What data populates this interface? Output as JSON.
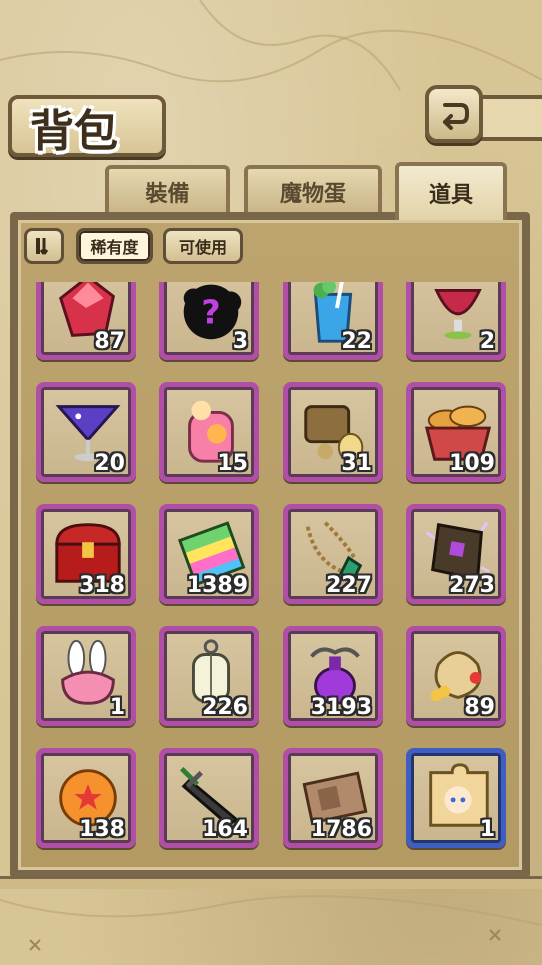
{
  "header": {
    "title": "背包"
  },
  "tabs": [
    {
      "label": "裝備",
      "active": false
    },
    {
      "label": "魔物蛋",
      "active": false
    },
    {
      "label": "道具",
      "active": true
    }
  ],
  "controls": {
    "filters": [
      {
        "label": "稀有度",
        "selected": true
      },
      {
        "label": "可使用",
        "selected": false
      }
    ]
  },
  "inventory": {
    "items": [
      {
        "icon": "red-gem-icon",
        "count": "87",
        "frame": "purple"
      },
      {
        "icon": "mystery-item-icon",
        "count": "3",
        "frame": "purple"
      },
      {
        "icon": "blue-drink-icon",
        "count": "22",
        "frame": "purple"
      },
      {
        "icon": "red-goblet-icon",
        "count": "2",
        "frame": "purple"
      },
      {
        "icon": "purple-cocktail-icon",
        "count": "20",
        "frame": "purple"
      },
      {
        "icon": "peach-juice-icon",
        "count": "15",
        "frame": "purple"
      },
      {
        "icon": "treasure-chest-items-icon",
        "count": "31",
        "frame": "purple"
      },
      {
        "icon": "bread-basket-icon",
        "count": "109",
        "frame": "purple"
      },
      {
        "icon": "red-chest-icon",
        "count": "318",
        "frame": "purple"
      },
      {
        "icon": "rainbow-book-icon",
        "count": "1389",
        "frame": "purple"
      },
      {
        "icon": "gem-necklace-icon",
        "count": "227",
        "frame": "purple"
      },
      {
        "icon": "magic-tome-icon",
        "count": "273",
        "frame": "purple"
      },
      {
        "icon": "bunny-hat-icon",
        "count": "1",
        "frame": "purple"
      },
      {
        "icon": "lantern-icon",
        "count": "226",
        "frame": "purple"
      },
      {
        "icon": "purple-potion-icon",
        "count": "3193",
        "frame": "purple"
      },
      {
        "icon": "gold-sack-icon",
        "count": "89",
        "frame": "purple"
      },
      {
        "icon": "star-orb-icon",
        "count": "138",
        "frame": "purple"
      },
      {
        "icon": "dark-sword-icon",
        "count": "164",
        "frame": "purple"
      },
      {
        "icon": "card-ticket-icon",
        "count": "1786",
        "frame": "purple"
      },
      {
        "icon": "puzzle-portrait-icon",
        "count": "1",
        "frame": "blue"
      }
    ]
  },
  "colors": {
    "purple_frame": "#b14ea6",
    "blue_frame": "#3d5fc4",
    "parchment": "#d8c595"
  }
}
